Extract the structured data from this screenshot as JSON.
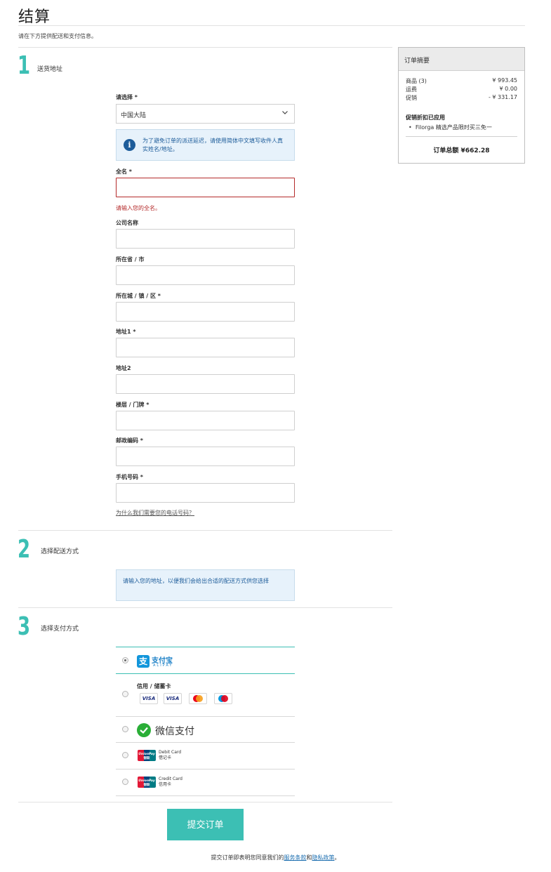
{
  "page": {
    "title": "结算",
    "subtitle": "请在下方提供配送和支付信息。"
  },
  "steps": [
    {
      "num": "1",
      "title": "送货地址"
    },
    {
      "num": "2",
      "title": "选择配送方式"
    },
    {
      "num": "3",
      "title": "选择支付方式"
    }
  ],
  "address_form": {
    "region_label": "请选择 *",
    "region_value": "中国大陆",
    "region_notice": "为了避免订单的派送延迟，请使用简体中文填写收件人真实姓名/地址。",
    "fullname_label": "全名 *",
    "fullname_error": "请输入您的全名。",
    "company_label": "公司名称",
    "province_label": "所在省 / 市",
    "city_label": "所在城 / 镇 / 区 *",
    "address1_label": "地址1 *",
    "address2_label": "地址2",
    "floor_label": "楼层 / 门牌 *",
    "postcode_label": "邮政编码 *",
    "phone_label": "手机号码 *",
    "phone_why_link": "为什么我们需要您的电话号码？"
  },
  "shipping": {
    "notice": "请输入您的地址，以便我们会给出合适的配送方式供您选择"
  },
  "payment": {
    "alipay_name": "支付宝",
    "alipay_sub": "ALIPAY",
    "card_title": "信用 / 储蓄卡",
    "card_brands": [
      "VISA",
      "VISA",
      "mastercard",
      "maestro"
    ],
    "wechat_name": "微信支付",
    "unionpay_brand": "UnionPay",
    "unionpay_brand_cn": "银联",
    "unionpay_debit_en": "Debit Card",
    "unionpay_debit_cn": "借记卡",
    "unionpay_credit_en": "Credit Card",
    "unionpay_credit_cn": "信用卡",
    "selected": "alipay"
  },
  "summary": {
    "title": "订单摘要",
    "items_label": "商品 (3)",
    "items_value": "¥ 993.45",
    "shipping_label": "运费",
    "shipping_value": "¥ 0.00",
    "promo_label": "促销",
    "promo_value": "- ¥ 331.17",
    "promo_applied_title": "促销折扣已应用",
    "promo_applied_item": "Filorga 精选产品限时买三免一",
    "total": "订单总额 ¥662.28"
  },
  "submit": {
    "button_label": "提交订单",
    "terms_prefix": "提交订单即表明您同意我们的",
    "terms_link": "服务条款",
    "terms_and": "和",
    "privacy_link": "隐私政策",
    "terms_suffix": "。"
  },
  "colors": {
    "accent": "#3cbfb4",
    "error": "#b42a2a",
    "info_bg": "#e7f2fb",
    "info_text": "#1d5c9a"
  }
}
